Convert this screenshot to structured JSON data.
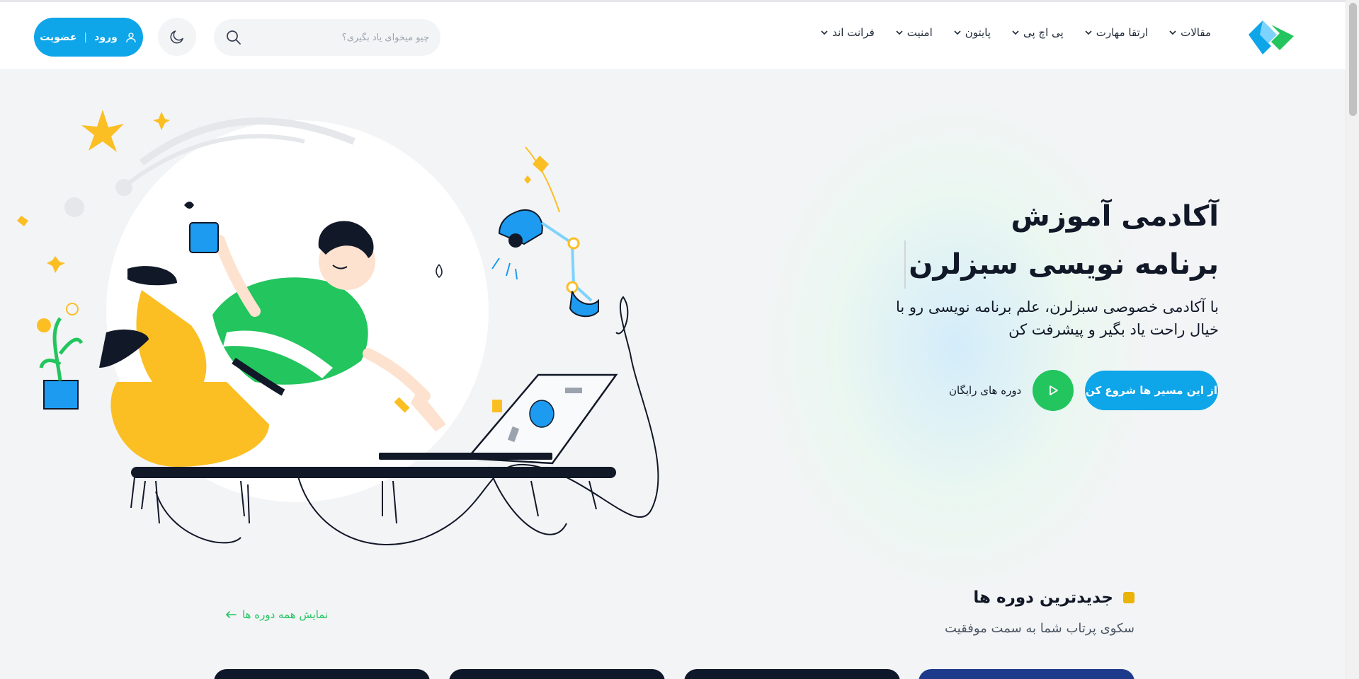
{
  "header": {
    "nav": [
      {
        "label": "فرانت اند"
      },
      {
        "label": "امنیت"
      },
      {
        "label": "پایتون"
      },
      {
        "label": "پی اچ پی"
      },
      {
        "label": "ارتقا مهارت"
      },
      {
        "label": "مقالات"
      }
    ],
    "search": {
      "placeholder": "چیو میخوای یاد بگیری؟"
    },
    "login": {
      "login_label": "ورود",
      "separator": "|",
      "signup_label": "عضویت"
    }
  },
  "hero": {
    "title_line1": "آکادمی آموزش",
    "title_line2": "برنامه نویسی سبزلرن",
    "description": "با آکادمی خصوصی سبزلرن، علم برنامه نویسی رو با خیال راحت یاد بگیر و پیشرفت کن",
    "cta_label": "از این مسیر ها شروع کن",
    "free_courses_label": "دوره های رایگان"
  },
  "latest": {
    "title": "جدیدترین دوره ها",
    "subtitle": "سکوی پرتاب شما به سمت موفقیت",
    "show_all": "نمایش همه دوره ها"
  },
  "colors": {
    "primary": "#0ea5e9",
    "green": "#22c55e",
    "yellow": "#eab308",
    "background": "#f3f4f6"
  }
}
